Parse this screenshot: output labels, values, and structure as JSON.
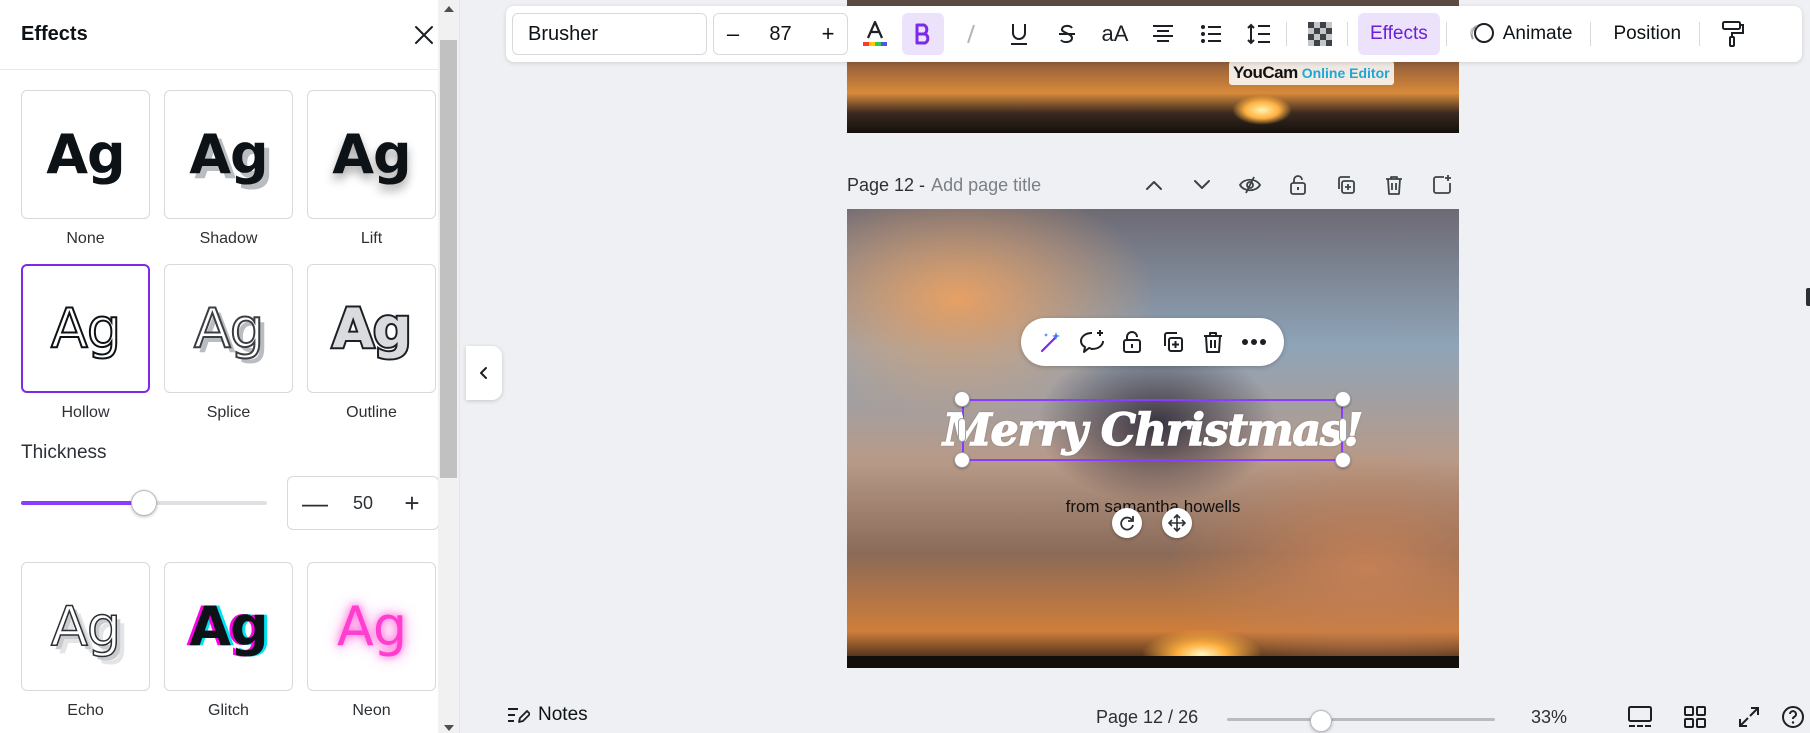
{
  "effects_panel": {
    "title": "Effects",
    "effects": [
      {
        "label": "None",
        "sample": "Ag",
        "style": "ag-none",
        "selected": false
      },
      {
        "label": "Shadow",
        "sample": "Ag",
        "style": "ag-shadow",
        "selected": false
      },
      {
        "label": "Lift",
        "sample": "Ag",
        "style": "ag-lift",
        "selected": false
      },
      {
        "label": "Hollow",
        "sample": "Ag",
        "style": "ag-hollow",
        "selected": true
      },
      {
        "label": "Splice",
        "sample": "Ag",
        "style": "ag-splice",
        "selected": false
      },
      {
        "label": "Outline",
        "sample": "Ag",
        "style": "ag-outline",
        "selected": false
      },
      {
        "label": "Echo",
        "sample": "Ag",
        "style": "ag-echo",
        "selected": false
      },
      {
        "label": "Glitch",
        "sample": "Ag",
        "style": "ag-glitch",
        "selected": false
      },
      {
        "label": "Neon",
        "sample": "Ag",
        "style": "ag-neon",
        "selected": false
      }
    ],
    "thickness": {
      "label": "Thickness",
      "value": "50",
      "min": 0,
      "max": 100,
      "minus": "—",
      "plus": "+"
    }
  },
  "toolbar": {
    "font": "Brusher",
    "font_size": "87",
    "size_minus": "–",
    "size_plus": "+",
    "case_label": "aA",
    "effects_label": "Effects",
    "animate_label": "Animate",
    "position_label": "Position"
  },
  "canvas": {
    "watermark_brand": "YouCam",
    "watermark_sub": "Online Editor",
    "page_number": "Page 12 -",
    "page_title_placeholder": "Add page title",
    "greeting": "Merry Christmas!",
    "sender": "from samantha howells"
  },
  "footer": {
    "notes_label": "Notes",
    "page_indicator": "Page 12 / 26",
    "zoom": "33%",
    "zoom_fraction": 0.33
  },
  "colors": {
    "accent": "#8b3dff",
    "selected_border": "#7d2ae8",
    "active_bg": "#ece2fc"
  }
}
